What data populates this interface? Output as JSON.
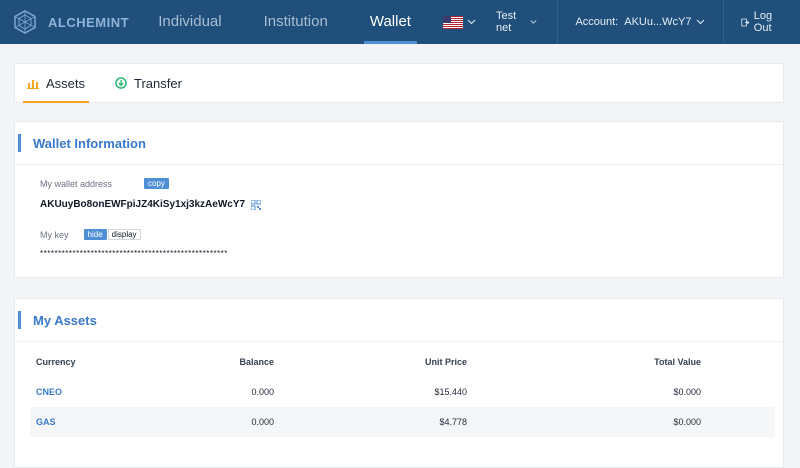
{
  "header": {
    "logo_text": "ALCHEMINT",
    "nav": [
      {
        "label": "Individual"
      },
      {
        "label": "Institution"
      },
      {
        "label": "Wallet"
      }
    ],
    "network": "Test net",
    "account_label": "Account:",
    "account_value": "AKUu...WcY7",
    "logout": "Log Out"
  },
  "tabs": [
    {
      "label": "Assets"
    },
    {
      "label": "Transfer"
    }
  ],
  "wallet": {
    "title": "Wallet Information",
    "address_label": "My wallet address",
    "copy_label": "copy",
    "address": "AKUuyBo8onEWFpiJZ4KiSy1xj3kzAeWcY7",
    "key_label": "My key",
    "hide_label": "hide",
    "display_label": "display",
    "key_mask": "****************************************************"
  },
  "assets": {
    "title": "My Assets",
    "columns": [
      "Currency",
      "Balance",
      "Unit Price",
      "Total Value"
    ],
    "rows": [
      [
        "CNEO",
        "0.000",
        "$15.440",
        "$0.000"
      ],
      [
        "GAS",
        "0.000",
        "$4.778",
        "$0.000"
      ]
    ]
  },
  "colors": {
    "topbar": "#1f4f7a",
    "accent": "#4f8fd6",
    "tab_underline": "#f5a623"
  }
}
